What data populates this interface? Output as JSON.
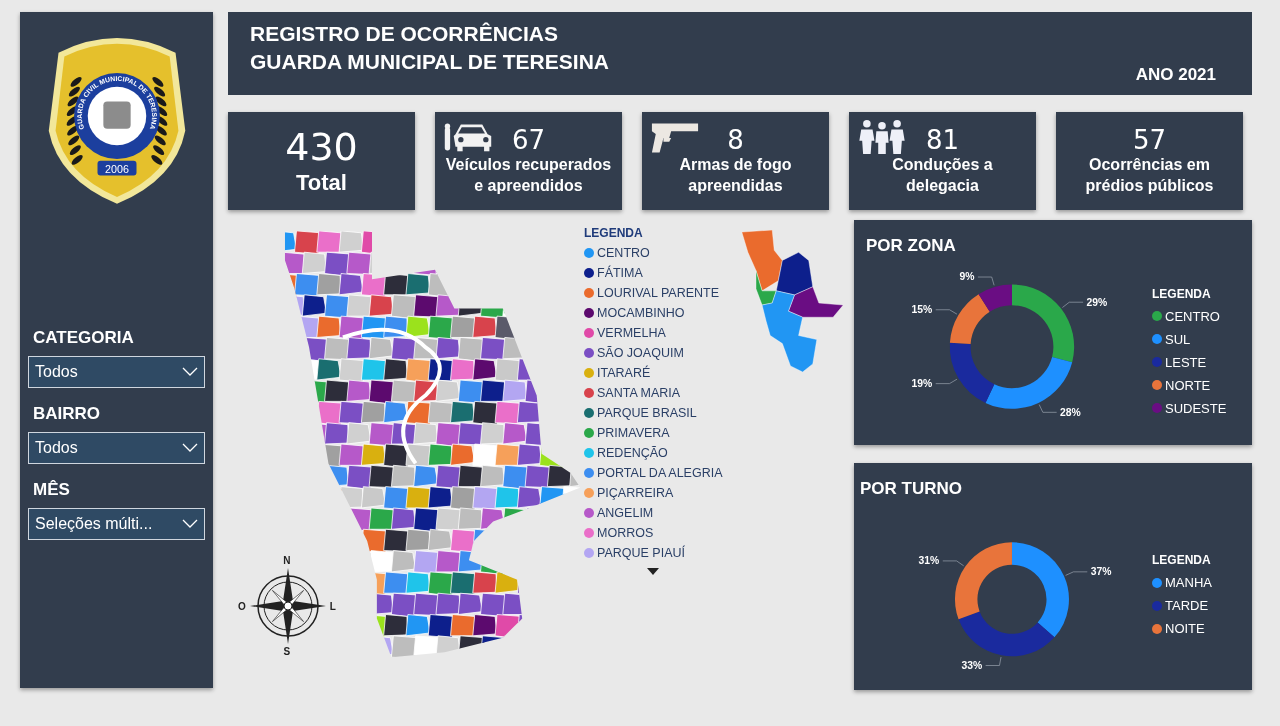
{
  "sidebar": {
    "badge": {
      "text": "GUARDA CIVIL MUNICIPAL DE TERESINA",
      "year": "2006"
    },
    "filters": [
      {
        "label": "CATEGORIA",
        "value": "Todos"
      },
      {
        "label": "BAIRRO",
        "value": "Todos"
      },
      {
        "label": "MÊS",
        "value": "Seleções múlti..."
      }
    ]
  },
  "header": {
    "title_lines": [
      "REGISTRO DE OCORRÊNCIAS",
      "GUARDA MUNICIPAL DE TERESINA"
    ],
    "year": "ANO 2021"
  },
  "kpis": [
    {
      "value": "430",
      "label": "Total"
    },
    {
      "value": "67",
      "label": "Veículos recuperados e apreendidos"
    },
    {
      "value": "8",
      "label": "Armas de fogo apreendidas"
    },
    {
      "value": "81",
      "label": "Conduções a delegacia"
    },
    {
      "value": "57",
      "label": "Ocorrências em prédios públicos"
    }
  ],
  "map": {
    "legend_title": "LEGENDA",
    "compass": {
      "north": "N",
      "south": "S",
      "west": "O",
      "east": "L"
    },
    "legend": [
      {
        "name": "CENTRO",
        "color": "#2196f3"
      },
      {
        "name": "FÁTIMA",
        "color": "#0d1f8c"
      },
      {
        "name": "LOURIVAL PARENTE",
        "color": "#ea6b2d"
      },
      {
        "name": "MOCAMBINHO",
        "color": "#5c0a6e"
      },
      {
        "name": "VERMELHA",
        "color": "#e04aa8"
      },
      {
        "name": "SÃO JOAQUIM",
        "color": "#7b4fc4"
      },
      {
        "name": "ITARARÉ",
        "color": "#d9b00f"
      },
      {
        "name": "SANTA MARIA",
        "color": "#d8434c"
      },
      {
        "name": "PARQUE BRASIL",
        "color": "#1a6e70"
      },
      {
        "name": "PRIMAVERA",
        "color": "#2ba84a"
      },
      {
        "name": "REDENÇÃO",
        "color": "#1fc4ea"
      },
      {
        "name": "PORTAL DA ALEGRIA",
        "color": "#3d8ef0"
      },
      {
        "name": "PIÇARREIRA",
        "color": "#f6a05a"
      },
      {
        "name": "ANGELIM",
        "color": "#b659c9"
      },
      {
        "name": "MORROS",
        "color": "#ea6fc9"
      },
      {
        "name": "PARQUE PIAUÍ",
        "color": "#b3a6f2"
      }
    ]
  },
  "charts": [
    {
      "title": "POR ZONA",
      "legend_title": "LEGENDA",
      "chart_data": {
        "type": "donut",
        "categories": [
          "CENTRO",
          "SUL",
          "LESTE",
          "NORTE",
          "SUDESTE"
        ],
        "values": [
          29,
          28,
          19,
          15,
          9
        ],
        "colors": [
          "#2aa84a",
          "#1e90ff",
          "#1a2a9e",
          "#e8743b",
          "#6a0d83"
        ],
        "value_labels": [
          "29%",
          "28%",
          "19%",
          "15%",
          "9%"
        ]
      }
    },
    {
      "title": "POR TURNO",
      "legend_title": "LEGENDA",
      "chart_data": {
        "type": "donut",
        "categories": [
          "MANHA",
          "TARDE",
          "NOITE"
        ],
        "values": [
          37,
          33,
          31
        ],
        "colors": [
          "#1e90ff",
          "#1a2a9e",
          "#e8743b"
        ],
        "value_labels": [
          "37%",
          "33%",
          "31%"
        ]
      }
    }
  ]
}
